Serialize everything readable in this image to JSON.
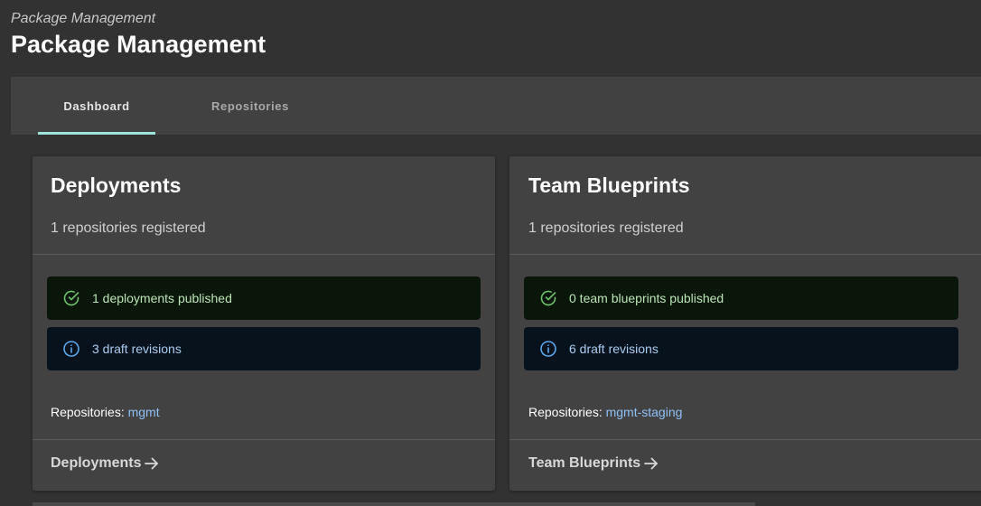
{
  "breadcrumb": "Package Management",
  "page_title": "Package Management",
  "tabs": [
    {
      "label": "Dashboard",
      "active": true
    },
    {
      "label": "Repositories",
      "active": false
    }
  ],
  "cards": [
    {
      "title": "Deployments",
      "subtitle": "1 repositories registered",
      "published_text": "1 deployments published",
      "drafts_text": "3 draft revisions",
      "repositories_label": "Repositories:",
      "repository": "mgmt",
      "footer_link": "Deployments"
    },
    {
      "title": "Team Blueprints",
      "subtitle": "1 repositories registered",
      "published_text": "0 team blueprints published",
      "drafts_text": "6 draft revisions",
      "repositories_label": "Repositories:",
      "repository": "mgmt-staging",
      "footer_link": "Team Blueprints"
    }
  ],
  "icons": {
    "published": "check-circle-icon",
    "drafts": "info-circle-icon",
    "footer": "arrow-right-icon"
  },
  "colors": {
    "accent": "#9ee6dc",
    "success_text": "#b9e6b5",
    "success_icon": "#6cc06a",
    "info_text": "#a9cdf0",
    "info_icon": "#5aa8ee",
    "link": "#8fc0f5"
  }
}
